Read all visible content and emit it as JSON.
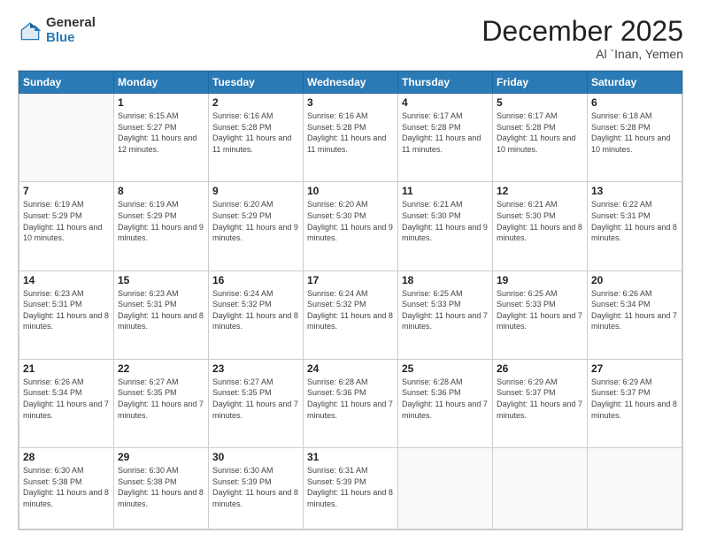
{
  "logo": {
    "general": "General",
    "blue": "Blue"
  },
  "header": {
    "month": "December 2025",
    "location": "Al `Inan, Yemen"
  },
  "weekdays": [
    "Sunday",
    "Monday",
    "Tuesday",
    "Wednesday",
    "Thursday",
    "Friday",
    "Saturday"
  ],
  "weeks": [
    [
      {
        "day": "",
        "info": ""
      },
      {
        "day": "1",
        "info": "Sunrise: 6:15 AM\nSunset: 5:27 PM\nDaylight: 11 hours and 12 minutes."
      },
      {
        "day": "2",
        "info": "Sunrise: 6:16 AM\nSunset: 5:28 PM\nDaylight: 11 hours and 11 minutes."
      },
      {
        "day": "3",
        "info": "Sunrise: 6:16 AM\nSunset: 5:28 PM\nDaylight: 11 hours and 11 minutes."
      },
      {
        "day": "4",
        "info": "Sunrise: 6:17 AM\nSunset: 5:28 PM\nDaylight: 11 hours and 11 minutes."
      },
      {
        "day": "5",
        "info": "Sunrise: 6:17 AM\nSunset: 5:28 PM\nDaylight: 11 hours and 10 minutes."
      },
      {
        "day": "6",
        "info": "Sunrise: 6:18 AM\nSunset: 5:28 PM\nDaylight: 11 hours and 10 minutes."
      }
    ],
    [
      {
        "day": "7",
        "info": "Sunrise: 6:19 AM\nSunset: 5:29 PM\nDaylight: 11 hours and 10 minutes."
      },
      {
        "day": "8",
        "info": "Sunrise: 6:19 AM\nSunset: 5:29 PM\nDaylight: 11 hours and 9 minutes."
      },
      {
        "day": "9",
        "info": "Sunrise: 6:20 AM\nSunset: 5:29 PM\nDaylight: 11 hours and 9 minutes."
      },
      {
        "day": "10",
        "info": "Sunrise: 6:20 AM\nSunset: 5:30 PM\nDaylight: 11 hours and 9 minutes."
      },
      {
        "day": "11",
        "info": "Sunrise: 6:21 AM\nSunset: 5:30 PM\nDaylight: 11 hours and 9 minutes."
      },
      {
        "day": "12",
        "info": "Sunrise: 6:21 AM\nSunset: 5:30 PM\nDaylight: 11 hours and 8 minutes."
      },
      {
        "day": "13",
        "info": "Sunrise: 6:22 AM\nSunset: 5:31 PM\nDaylight: 11 hours and 8 minutes."
      }
    ],
    [
      {
        "day": "14",
        "info": "Sunrise: 6:23 AM\nSunset: 5:31 PM\nDaylight: 11 hours and 8 minutes."
      },
      {
        "day": "15",
        "info": "Sunrise: 6:23 AM\nSunset: 5:31 PM\nDaylight: 11 hours and 8 minutes."
      },
      {
        "day": "16",
        "info": "Sunrise: 6:24 AM\nSunset: 5:32 PM\nDaylight: 11 hours and 8 minutes."
      },
      {
        "day": "17",
        "info": "Sunrise: 6:24 AM\nSunset: 5:32 PM\nDaylight: 11 hours and 8 minutes."
      },
      {
        "day": "18",
        "info": "Sunrise: 6:25 AM\nSunset: 5:33 PM\nDaylight: 11 hours and 7 minutes."
      },
      {
        "day": "19",
        "info": "Sunrise: 6:25 AM\nSunset: 5:33 PM\nDaylight: 11 hours and 7 minutes."
      },
      {
        "day": "20",
        "info": "Sunrise: 6:26 AM\nSunset: 5:34 PM\nDaylight: 11 hours and 7 minutes."
      }
    ],
    [
      {
        "day": "21",
        "info": "Sunrise: 6:26 AM\nSunset: 5:34 PM\nDaylight: 11 hours and 7 minutes."
      },
      {
        "day": "22",
        "info": "Sunrise: 6:27 AM\nSunset: 5:35 PM\nDaylight: 11 hours and 7 minutes."
      },
      {
        "day": "23",
        "info": "Sunrise: 6:27 AM\nSunset: 5:35 PM\nDaylight: 11 hours and 7 minutes."
      },
      {
        "day": "24",
        "info": "Sunrise: 6:28 AM\nSunset: 5:36 PM\nDaylight: 11 hours and 7 minutes."
      },
      {
        "day": "25",
        "info": "Sunrise: 6:28 AM\nSunset: 5:36 PM\nDaylight: 11 hours and 7 minutes."
      },
      {
        "day": "26",
        "info": "Sunrise: 6:29 AM\nSunset: 5:37 PM\nDaylight: 11 hours and 7 minutes."
      },
      {
        "day": "27",
        "info": "Sunrise: 6:29 AM\nSunset: 5:37 PM\nDaylight: 11 hours and 8 minutes."
      }
    ],
    [
      {
        "day": "28",
        "info": "Sunrise: 6:30 AM\nSunset: 5:38 PM\nDaylight: 11 hours and 8 minutes."
      },
      {
        "day": "29",
        "info": "Sunrise: 6:30 AM\nSunset: 5:38 PM\nDaylight: 11 hours and 8 minutes."
      },
      {
        "day": "30",
        "info": "Sunrise: 6:30 AM\nSunset: 5:39 PM\nDaylight: 11 hours and 8 minutes."
      },
      {
        "day": "31",
        "info": "Sunrise: 6:31 AM\nSunset: 5:39 PM\nDaylight: 11 hours and 8 minutes."
      },
      {
        "day": "",
        "info": ""
      },
      {
        "day": "",
        "info": ""
      },
      {
        "day": "",
        "info": ""
      }
    ]
  ]
}
